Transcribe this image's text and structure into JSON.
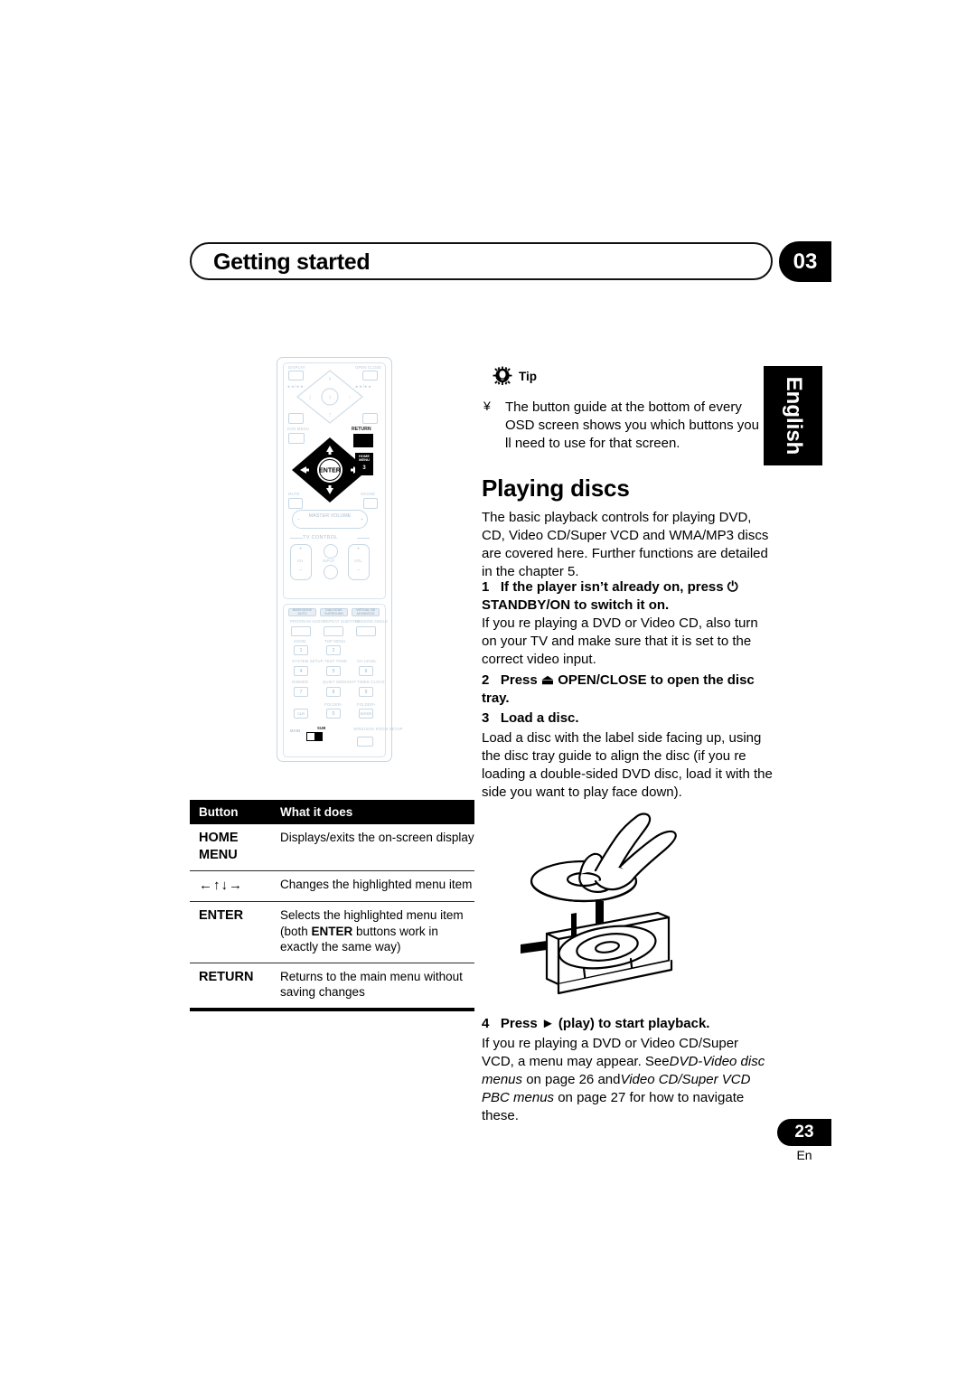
{
  "header": {
    "title": "Getting started",
    "chapter": "03"
  },
  "sidetab": {
    "language": "English"
  },
  "remote": {
    "labels": {
      "display": "DISPLAY",
      "open_close": "OPEN CLOSE",
      "prev_rev": "◄◄/◄◄",
      "next_fwd": "►►/►►",
      "dvd_menu": "DVD MENU",
      "return": "RETURN",
      "enter": "ENTER",
      "mute": "MUTE",
      "sound": "SOUND",
      "master_volume": "MASTER VOLUME",
      "tv_control": "TV CONTROL",
      "ch": "CH",
      "input": "INPUT",
      "vol": "VOL",
      "bass_mode_auto": "BASS MODE AUTO",
      "dialogue_surround": "DIALOGUE SURROUND",
      "virtual_sb_advanced": "VIRTUAL SB ADVANCED",
      "program_audio": "PROGRAM AUDIO",
      "repeat_subtitle": "REPEAT SUBTITLE",
      "random_angle": "RANDOM ANGLE",
      "zoom": "ZOOM",
      "top_menu": "TOP MENU",
      "home_menu": "HOME MENU",
      "system_setup": "SYSTEM SETUP",
      "test_tone": "TEST TONE",
      "ch_level": "CH LEVEL",
      "dimmer": "DIMMER",
      "quiet_midnight": "QUIET MIDNIGHT",
      "timer_clock": "TIMER CLOCK",
      "clr": "CLR",
      "folder_minus": "FOLDER-",
      "folder_plus": "FOLDER+",
      "enter_key": "ENTER",
      "main": "MAIN",
      "sub": "SUB",
      "wireless_room_setup": "WIRELESS ROOM SETUP"
    },
    "keys": [
      "1",
      "2",
      "3",
      "4",
      "5",
      "6",
      "7",
      "8",
      "9",
      "0"
    ]
  },
  "button_table": {
    "headers": [
      "Button",
      "What it does"
    ],
    "rows": [
      {
        "button": "HOME\nMENU",
        "desc": "Displays/exits the on-screen display"
      },
      {
        "button": "←↑↓→",
        "desc": "Changes the highlighted menu item"
      },
      {
        "button": "ENTER",
        "desc_pre": "Selects the highlighted menu item (both ",
        "desc_bold": "ENTER",
        "desc_post": " buttons work in exactly the same way)"
      },
      {
        "button": "RETURN",
        "desc": "Returns to the main menu without saving changes"
      }
    ]
  },
  "tip": {
    "label": "Tip",
    "bullet": "¥",
    "text": "The button guide at the bottom of every OSD screen shows you which buttons you ll need to use for that screen."
  },
  "playing_discs": {
    "heading": "Playing discs",
    "intro": "The basic playback controls for playing DVD, CD, Video CD/Super VCD and WMA/MP3 discs are covered here. Further functions are detailed in the chapter 5.",
    "step1_num": "1",
    "step1_title": "If the player isn’t already on, press ⏻ STANDBY/ON to switch it on.",
    "step1_body": "If you re playing a DVD or Video CD, also turn on your TV and make sure that it is set to the correct video input.",
    "step2_num": "2",
    "step2_title": "Press ⏏ OPEN/CLOSE to open the disc tray.",
    "step3_num": "3",
    "step3_title": "Load a disc.",
    "step3_body": "Load a disc with the label side facing up, using the disc tray guide to align the disc (if you re loading a double-sided DVD disc, load it with the side you want to play face down).",
    "step4_num": "4",
    "step4_title": "Press ► (play) to start playback.",
    "step4_body_1": "If you re playing a DVD or Video CD/Super VCD, a menu may appear. See",
    "step4_italic_1": "DVD-Video disc menus",
    "step4_body_2": " on page 26 and",
    "step4_italic_2": "Video CD/Super VCD PBC menus",
    "step4_body_3": " on page 27 for how to navigate these."
  },
  "footer": {
    "page": "23",
    "language_code": "En"
  }
}
